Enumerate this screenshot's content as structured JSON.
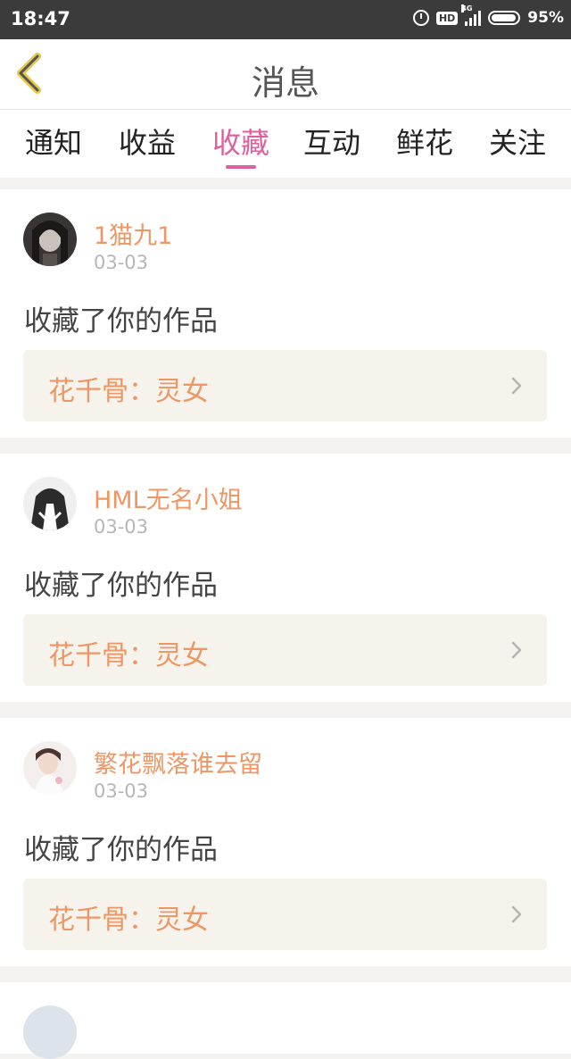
{
  "status_bar": {
    "time": "18:47",
    "hd": "HD",
    "network": "4G",
    "battery": "95%",
    "battery_level": 0.95
  },
  "header": {
    "title": "消息",
    "back_icon": "chevron-left-icon",
    "accent_color": "#e0609e"
  },
  "tabs": [
    {
      "label": "通知",
      "active": false
    },
    {
      "label": "收益",
      "active": false
    },
    {
      "label": "收藏",
      "active": true
    },
    {
      "label": "互动",
      "active": false
    },
    {
      "label": "鲜花",
      "active": false
    },
    {
      "label": "关注",
      "active": false
    }
  ],
  "messages": [
    {
      "username": "1猫九1",
      "date": "03-03",
      "action": "收藏了你的作品",
      "work": "花千骨：灵女"
    },
    {
      "username": "HML无名小姐",
      "date": "03-03",
      "action": "收藏了你的作品",
      "work": "花千骨：灵女"
    },
    {
      "username": "繁花飘落谁去留",
      "date": "03-03",
      "action": "收藏了你的作品",
      "work": "花千骨：灵女"
    }
  ]
}
